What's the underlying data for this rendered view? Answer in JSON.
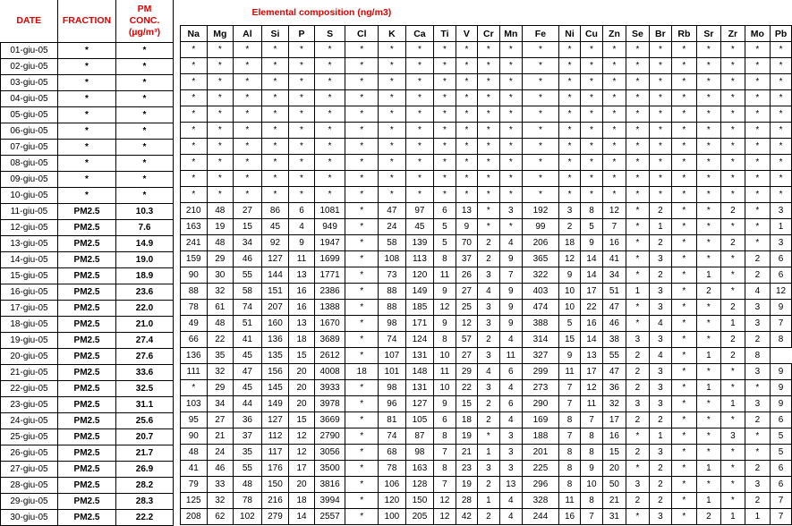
{
  "headers": {
    "date": "DATE",
    "fraction": "FRACTION",
    "pm_line1": "PM",
    "pm_line2": "CONC.",
    "pm_unit": "(µg/m³)",
    "title": "Elemental composition (ng/m3)"
  },
  "elements": [
    "Na",
    "Mg",
    "Al",
    "Si",
    "P",
    "S",
    "Cl",
    "K",
    "Ca",
    "Ti",
    "V",
    "Cr",
    "Mn",
    "Fe",
    "Ni",
    "Cu",
    "Zn",
    "Se",
    "Br",
    "Rb",
    "Sr",
    "Zr",
    "Mo",
    "Pb"
  ],
  "rows": [
    {
      "date": "01-giu-05",
      "fraction": "*",
      "pm": "*",
      "v": [
        "*",
        "*",
        "*",
        "*",
        "*",
        "*",
        "*",
        "*",
        "*",
        "*",
        "*",
        "*",
        "*",
        "*",
        "*",
        "*",
        "*",
        "*",
        "*",
        "*",
        "*",
        "*",
        "*",
        "*"
      ]
    },
    {
      "date": "02-giu-05",
      "fraction": "*",
      "pm": "*",
      "v": [
        "*",
        "*",
        "*",
        "*",
        "*",
        "*",
        "*",
        "*",
        "*",
        "*",
        "*",
        "*",
        "*",
        "*",
        "*",
        "*",
        "*",
        "*",
        "*",
        "*",
        "*",
        "*",
        "*",
        "*"
      ]
    },
    {
      "date": "03-giu-05",
      "fraction": "*",
      "pm": "*",
      "v": [
        "*",
        "*",
        "*",
        "*",
        "*",
        "*",
        "*",
        "*",
        "*",
        "*",
        "*",
        "*",
        "*",
        "*",
        "*",
        "*",
        "*",
        "*",
        "*",
        "*",
        "*",
        "*",
        "*",
        "*"
      ]
    },
    {
      "date": "04-giu-05",
      "fraction": "*",
      "pm": "*",
      "v": [
        "*",
        "*",
        "*",
        "*",
        "*",
        "*",
        "*",
        "*",
        "*",
        "*",
        "*",
        "*",
        "*",
        "*",
        "*",
        "*",
        "*",
        "*",
        "*",
        "*",
        "*",
        "*",
        "*",
        "*"
      ]
    },
    {
      "date": "05-giu-05",
      "fraction": "*",
      "pm": "*",
      "v": [
        "*",
        "*",
        "*",
        "*",
        "*",
        "*",
        "*",
        "*",
        "*",
        "*",
        "*",
        "*",
        "*",
        "*",
        "*",
        "*",
        "*",
        "*",
        "*",
        "*",
        "*",
        "*",
        "*",
        "*"
      ]
    },
    {
      "date": "06-giu-05",
      "fraction": "*",
      "pm": "*",
      "v": [
        "*",
        "*",
        "*",
        "*",
        "*",
        "*",
        "*",
        "*",
        "*",
        "*",
        "*",
        "*",
        "*",
        "*",
        "*",
        "*",
        "*",
        "*",
        "*",
        "*",
        "*",
        "*",
        "*",
        "*"
      ]
    },
    {
      "date": "07-giu-05",
      "fraction": "*",
      "pm": "*",
      "v": [
        "*",
        "*",
        "*",
        "*",
        "*",
        "*",
        "*",
        "*",
        "*",
        "*",
        "*",
        "*",
        "*",
        "*",
        "*",
        "*",
        "*",
        "*",
        "*",
        "*",
        "*",
        "*",
        "*",
        "*"
      ]
    },
    {
      "date": "08-giu-05",
      "fraction": "*",
      "pm": "*",
      "v": [
        "*",
        "*",
        "*",
        "*",
        "*",
        "*",
        "*",
        "*",
        "*",
        "*",
        "*",
        "*",
        "*",
        "*",
        "*",
        "*",
        "*",
        "*",
        "*",
        "*",
        "*",
        "*",
        "*",
        "*"
      ]
    },
    {
      "date": "09-giu-05",
      "fraction": "*",
      "pm": "*",
      "v": [
        "*",
        "*",
        "*",
        "*",
        "*",
        "*",
        "*",
        "*",
        "*",
        "*",
        "*",
        "*",
        "*",
        "*",
        "*",
        "*",
        "*",
        "*",
        "*",
        "*",
        "*",
        "*",
        "*",
        "*"
      ]
    },
    {
      "date": "10-giu-05",
      "fraction": "*",
      "pm": "*",
      "v": [
        "*",
        "*",
        "*",
        "*",
        "*",
        "*",
        "*",
        "*",
        "*",
        "*",
        "*",
        "*",
        "*",
        "*",
        "*",
        "*",
        "*",
        "*",
        "*",
        "*",
        "*",
        "*",
        "*",
        "*"
      ]
    },
    {
      "date": "11-giu-05",
      "fraction": "PM2.5",
      "pm": "10.3",
      "v": [
        "210",
        "48",
        "27",
        "86",
        "6",
        "1081",
        "*",
        "47",
        "97",
        "6",
        "13",
        "*",
        "3",
        "192",
        "3",
        "8",
        "12",
        "*",
        "2",
        "*",
        "*",
        "2",
        "*",
        "3"
      ]
    },
    {
      "date": "12-giu-05",
      "fraction": "PM2.5",
      "pm": "7.6",
      "v": [
        "163",
        "19",
        "15",
        "45",
        "4",
        "949",
        "*",
        "24",
        "45",
        "5",
        "9",
        "*",
        "*",
        "99",
        "2",
        "5",
        "7",
        "*",
        "1",
        "*",
        "*",
        "*",
        "*",
        "1"
      ]
    },
    {
      "date": "13-giu-05",
      "fraction": "PM2.5",
      "pm": "14.9",
      "v": [
        "241",
        "48",
        "34",
        "92",
        "9",
        "1947",
        "*",
        "58",
        "139",
        "5",
        "70",
        "2",
        "4",
        "206",
        "18",
        "9",
        "16",
        "*",
        "2",
        "*",
        "*",
        "2",
        "*",
        "3"
      ]
    },
    {
      "date": "14-giu-05",
      "fraction": "PM2.5",
      "pm": "19.0",
      "v": [
        "159",
        "29",
        "46",
        "127",
        "11",
        "1699",
        "*",
        "108",
        "113",
        "8",
        "37",
        "2",
        "9",
        "365",
        "12",
        "14",
        "41",
        "*",
        "3",
        "*",
        "*",
        "*",
        "2",
        "6"
      ]
    },
    {
      "date": "15-giu-05",
      "fraction": "PM2.5",
      "pm": "18.9",
      "v": [
        "90",
        "30",
        "55",
        "144",
        "13",
        "1771",
        "*",
        "73",
        "120",
        "11",
        "26",
        "3",
        "7",
        "322",
        "9",
        "14",
        "34",
        "*",
        "2",
        "*",
        "1",
        "*",
        "2",
        "6"
      ]
    },
    {
      "date": "16-giu-05",
      "fraction": "PM2.5",
      "pm": "23.6",
      "v": [
        "88",
        "32",
        "58",
        "151",
        "16",
        "2386",
        "*",
        "88",
        "149",
        "9",
        "27",
        "4",
        "9",
        "403",
        "10",
        "17",
        "51",
        "1",
        "3",
        "*",
        "2",
        "*",
        "4",
        "12"
      ]
    },
    {
      "date": "17-giu-05",
      "fraction": "PM2.5",
      "pm": "22.0",
      "v": [
        "78",
        "61",
        "74",
        "207",
        "16",
        "1388",
        "*",
        "88",
        "185",
        "12",
        "25",
        "3",
        "9",
        "474",
        "10",
        "22",
        "47",
        "*",
        "3",
        "*",
        "*",
        "2",
        "3",
        "9"
      ]
    },
    {
      "date": "18-giu-05",
      "fraction": "PM2.5",
      "pm": "21.0",
      "v": [
        "49",
        "48",
        "51",
        "160",
        "13",
        "1670",
        "*",
        "98",
        "171",
        "9",
        "12",
        "3",
        "9",
        "388",
        "5",
        "16",
        "46",
        "*",
        "4",
        "*",
        "*",
        "1",
        "3",
        "7"
      ]
    },
    {
      "date": "19-giu-05",
      "fraction": "PM2.5",
      "pm": "27.4",
      "v": [
        "66",
        "22",
        "41",
        "136",
        "18",
        "3689",
        "*",
        "74",
        "124",
        "8",
        "57",
        "2",
        "4",
        "314",
        "15",
        "14",
        "38",
        "3",
        "3",
        "*",
        "*",
        "2",
        "2",
        "8"
      ]
    },
    {
      "date": "20-giu-05",
      "fraction": "PM2.5",
      "pm": "27.6",
      "v": [
        "136",
        "35",
        "45",
        "135",
        "15",
        "2612",
        "*",
        "107",
        "131",
        "10",
        "27",
        "3",
        "11",
        "327",
        "9",
        "13",
        "55",
        "2",
        "4",
        "*",
        "1",
        "2",
        "8"
      ]
    },
    {
      "date": "21-giu-05",
      "fraction": "PM2.5",
      "pm": "33.6",
      "v": [
        "111",
        "32",
        "47",
        "156",
        "20",
        "4008",
        "18",
        "101",
        "148",
        "11",
        "29",
        "4",
        "6",
        "299",
        "11",
        "17",
        "47",
        "2",
        "3",
        "*",
        "*",
        "*",
        "3",
        "9"
      ]
    },
    {
      "date": "22-giu-05",
      "fraction": "PM2.5",
      "pm": "32.5",
      "v": [
        "*",
        "29",
        "45",
        "145",
        "20",
        "3933",
        "*",
        "98",
        "131",
        "10",
        "22",
        "3",
        "4",
        "273",
        "7",
        "12",
        "36",
        "2",
        "3",
        "*",
        "1",
        "*",
        "*",
        "9"
      ]
    },
    {
      "date": "23-giu-05",
      "fraction": "PM2.5",
      "pm": "31.1",
      "v": [
        "103",
        "34",
        "44",
        "149",
        "20",
        "3978",
        "*",
        "96",
        "127",
        "9",
        "15",
        "2",
        "6",
        "290",
        "7",
        "11",
        "32",
        "3",
        "3",
        "*",
        "*",
        "1",
        "3",
        "9"
      ]
    },
    {
      "date": "24-giu-05",
      "fraction": "PM2.5",
      "pm": "25.6",
      "v": [
        "95",
        "27",
        "36",
        "127",
        "15",
        "3669",
        "*",
        "81",
        "105",
        "6",
        "18",
        "2",
        "4",
        "169",
        "8",
        "7",
        "17",
        "2",
        "2",
        "*",
        "*",
        "*",
        "2",
        "6"
      ]
    },
    {
      "date": "25-giu-05",
      "fraction": "PM2.5",
      "pm": "20.7",
      "v": [
        "90",
        "21",
        "37",
        "112",
        "12",
        "2790",
        "*",
        "74",
        "87",
        "8",
        "19",
        "*",
        "3",
        "188",
        "7",
        "8",
        "16",
        "*",
        "1",
        "*",
        "*",
        "3",
        "*",
        "5"
      ]
    },
    {
      "date": "26-giu-05",
      "fraction": "PM2.5",
      "pm": "21.7",
      "v": [
        "48",
        "24",
        "35",
        "117",
        "12",
        "3056",
        "*",
        "68",
        "98",
        "7",
        "21",
        "1",
        "3",
        "201",
        "8",
        "8",
        "15",
        "2",
        "3",
        "*",
        "*",
        "*",
        "*",
        "5"
      ]
    },
    {
      "date": "27-giu-05",
      "fraction": "PM2.5",
      "pm": "26.9",
      "v": [
        "41",
        "46",
        "55",
        "176",
        "17",
        "3500",
        "*",
        "78",
        "163",
        "8",
        "23",
        "3",
        "3",
        "225",
        "8",
        "9",
        "20",
        "*",
        "2",
        "*",
        "1",
        "*",
        "2",
        "6"
      ]
    },
    {
      "date": "28-giu-05",
      "fraction": "PM2.5",
      "pm": "28.2",
      "v": [
        "79",
        "33",
        "48",
        "150",
        "20",
        "3816",
        "*",
        "106",
        "128",
        "7",
        "19",
        "2",
        "13",
        "296",
        "8",
        "10",
        "50",
        "3",
        "2",
        "*",
        "*",
        "*",
        "3",
        "6"
      ]
    },
    {
      "date": "29-giu-05",
      "fraction": "PM2.5",
      "pm": "28.3",
      "v": [
        "125",
        "32",
        "78",
        "216",
        "18",
        "3994",
        "*",
        "120",
        "150",
        "12",
        "28",
        "1",
        "4",
        "328",
        "11",
        "8",
        "21",
        "2",
        "2",
        "*",
        "1",
        "*",
        "2",
        "7"
      ]
    },
    {
      "date": "30-giu-05",
      "fraction": "PM2.5",
      "pm": "22.2",
      "v": [
        "208",
        "62",
        "102",
        "279",
        "14",
        "2557",
        "*",
        "100",
        "205",
        "12",
        "42",
        "2",
        "4",
        "244",
        "16",
        "7",
        "31",
        "*",
        "3",
        "*",
        "2",
        "1",
        "1",
        "7"
      ]
    }
  ]
}
